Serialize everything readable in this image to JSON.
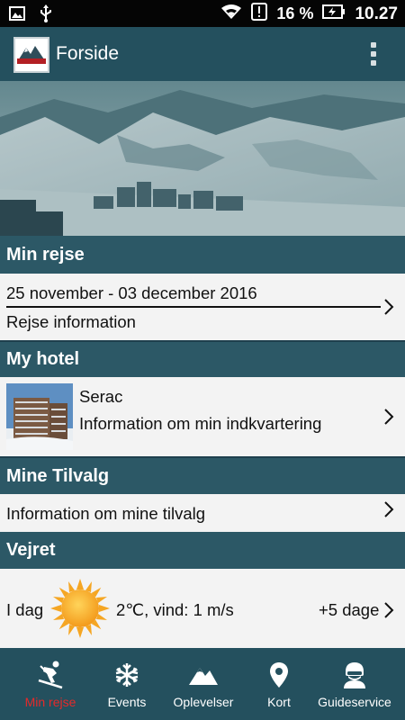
{
  "status_bar": {
    "battery_percent": "16 %",
    "time": "10.27"
  },
  "app_bar": {
    "title": "Forside",
    "logo_text": "SUMMIT"
  },
  "sections": {
    "trip": {
      "heading": "Min rejse",
      "dates": "25 november - 03 december 2016",
      "info_label": "Rejse information"
    },
    "hotel": {
      "heading": "My hotel",
      "name": "Serac",
      "info_label": "Information om min indkvartering"
    },
    "addons": {
      "heading": "Mine Tilvalg",
      "info_label": "Information om mine tilvalg"
    },
    "weather": {
      "heading": "Vejret",
      "day_label": "I dag",
      "icon": "sun-icon",
      "conditions": "2℃, vind: 1 m/s",
      "forecast_link": "+5 dage"
    }
  },
  "bottom_nav": {
    "items": [
      {
        "label": "Min rejse",
        "icon": "skier-icon",
        "active": true
      },
      {
        "label": "Events",
        "icon": "snowflake-icon",
        "active": false
      },
      {
        "label": "Oplevelser",
        "icon": "mountains-icon",
        "active": false
      },
      {
        "label": "Kort",
        "icon": "map-pin-icon",
        "active": false
      },
      {
        "label": "Guideservice",
        "icon": "guide-icon",
        "active": false
      }
    ]
  },
  "colors": {
    "primary": "#24505e",
    "section_header": "#2c5866",
    "row_background": "#f3f3f3",
    "active_nav": "#e52a2a",
    "sun": "#f5a623"
  }
}
